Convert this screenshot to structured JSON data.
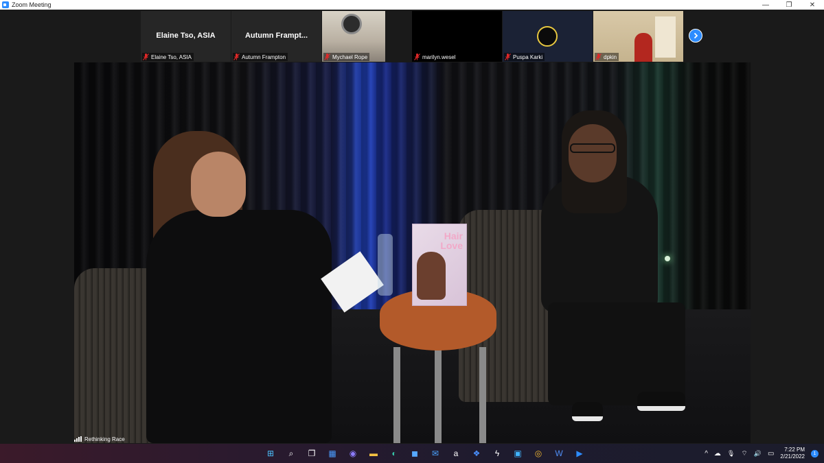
{
  "window": {
    "title": "Zoom Meeting",
    "controls": {
      "minimize": "—",
      "restore": "❐",
      "close": "✕"
    }
  },
  "participants": [
    {
      "display_name": "Elaine Tso, ASIA",
      "label": "Elaine Tso, ASIA",
      "muted": true
    },
    {
      "display_name": "Autumn  Frampt...",
      "label": "Autumn Frampton",
      "muted": true
    },
    {
      "label": "Mychael Rope",
      "muted": true
    },
    {
      "label": "marilyn.wesel",
      "muted": true
    },
    {
      "label": "Puspa Karki",
      "muted": true
    },
    {
      "label": "dpkin",
      "muted": true
    }
  ],
  "main_video": {
    "speaker_label": "Rethinking Race",
    "book_title_line1": "Hair",
    "book_title_line2": "Love"
  },
  "taskbar": {
    "apps": [
      {
        "icon": "windows-start-icon",
        "glyph": "⊞",
        "color": "#4cc2ff"
      },
      {
        "icon": "search-icon",
        "glyph": "⌕",
        "color": "#ffffff"
      },
      {
        "icon": "task-view-icon",
        "glyph": "❐",
        "color": "#ffffff"
      },
      {
        "icon": "widgets-icon",
        "glyph": "▦",
        "color": "#4a9cff"
      },
      {
        "icon": "teams-chat-icon",
        "glyph": "◉",
        "color": "#8d7cff"
      },
      {
        "icon": "file-explorer-icon",
        "glyph": "▬",
        "color": "#f5c242"
      },
      {
        "icon": "edge-icon",
        "glyph": "◐",
        "color": "#35c3a6"
      },
      {
        "icon": "store-icon",
        "glyph": "◼",
        "color": "#57a8ff"
      },
      {
        "icon": "mail-icon",
        "glyph": "✉",
        "color": "#4aa3ff"
      },
      {
        "icon": "amazon-icon",
        "glyph": "a",
        "color": "#ffffff"
      },
      {
        "icon": "dropbox-icon",
        "glyph": "❖",
        "color": "#4a90ff"
      },
      {
        "icon": "power-automate-icon",
        "glyph": "ϟ",
        "color": "#ffffff"
      },
      {
        "icon": "photos-icon",
        "glyph": "▣",
        "color": "#41b6ff"
      },
      {
        "icon": "chrome-icon",
        "glyph": "◎",
        "color": "#f2b632"
      },
      {
        "icon": "word-icon",
        "glyph": "W",
        "color": "#4f8df5"
      },
      {
        "icon": "zoom-icon",
        "glyph": "▶",
        "color": "#2d8cff"
      }
    ],
    "tray": {
      "chevron": "^",
      "cloud": "☁",
      "mic": "🎙",
      "wifi": "⌔",
      "volume": "🔊",
      "battery": "▭",
      "time": "7:22 PM",
      "date": "2/21/2022",
      "notifications": "1"
    }
  },
  "colors": {
    "zoom_blue": "#2d8cff",
    "muted_red": "#e02828"
  }
}
